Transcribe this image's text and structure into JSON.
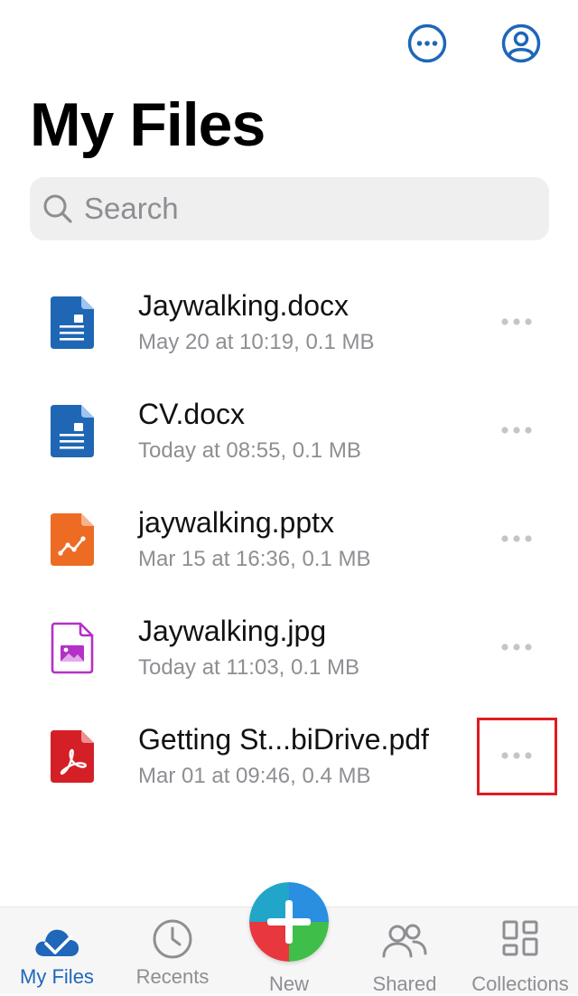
{
  "header": {
    "title": "My Files",
    "more_icon": "more-horizontal-circle-icon",
    "account_icon": "account-circle-icon"
  },
  "search": {
    "placeholder": "Search",
    "value": ""
  },
  "files": [
    {
      "name": "Jaywalking.docx",
      "meta": "May 20 at 10:19, 0.1 MB",
      "type": "docx",
      "icon": "word-document-icon"
    },
    {
      "name": "CV.docx",
      "meta": "Today at 08:55, 0.1 MB",
      "type": "docx",
      "icon": "word-document-icon"
    },
    {
      "name": "jaywalking.pptx",
      "meta": "Mar 15 at 16:36, 0.1 MB",
      "type": "pptx",
      "icon": "presentation-document-icon"
    },
    {
      "name": "Jaywalking.jpg",
      "meta": "Today at 11:03, 0.1 MB",
      "type": "jpg",
      "icon": "image-file-icon"
    },
    {
      "name": "Getting St...biDrive.pdf",
      "meta": "Mar 01 at 09:46, 0.4 MB",
      "type": "pdf",
      "icon": "pdf-file-icon"
    }
  ],
  "tabs": [
    {
      "label": "My Files",
      "icon": "cloud-icon",
      "active": true
    },
    {
      "label": "Recents",
      "icon": "clock-icon",
      "active": false
    },
    {
      "label": "New",
      "icon": "plus-icon",
      "active": false
    },
    {
      "label": "Shared",
      "icon": "people-icon",
      "active": false
    },
    {
      "label": "Collections",
      "icon": "collections-grid-icon",
      "active": false
    }
  ],
  "colors": {
    "accent": "#1e67b9",
    "docx": "#1f66b5",
    "pptx": "#ee6b24",
    "image": "#b431c6",
    "pdf": "#d41f26",
    "highlight": "#e01b22",
    "secondary_text": "#8e8e93"
  }
}
